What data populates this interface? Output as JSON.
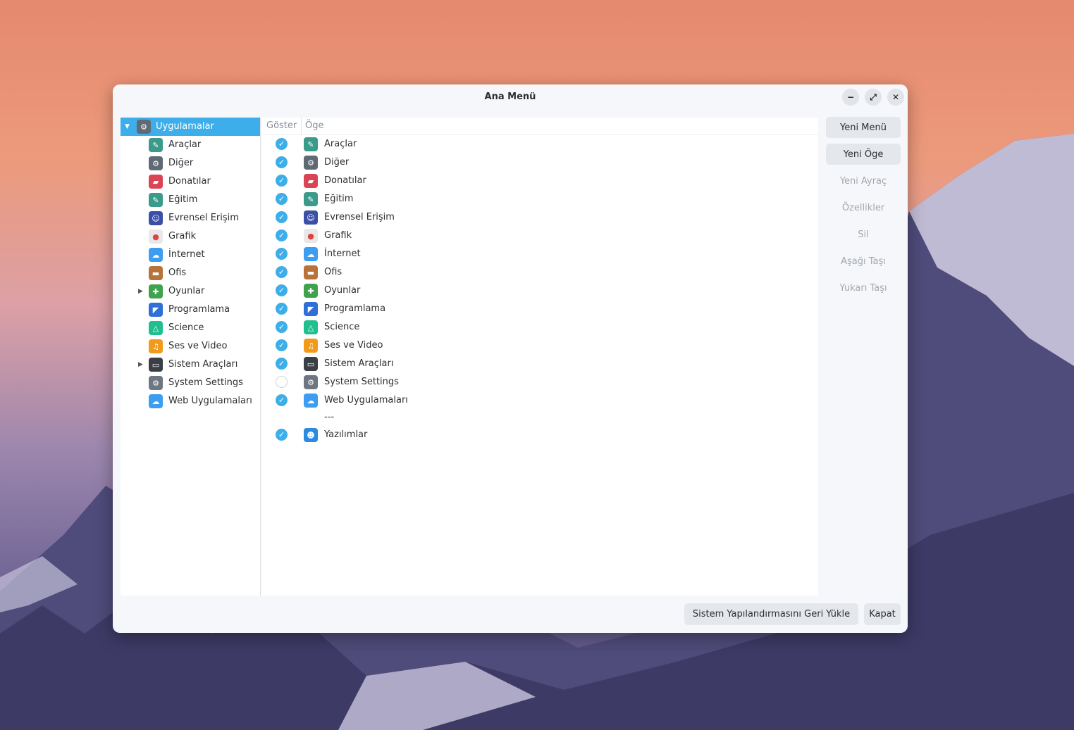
{
  "window": {
    "title": "Ana Menü",
    "controls": {
      "minimize": "−",
      "maximize": "⤢",
      "close": "✕"
    }
  },
  "tree": {
    "root": {
      "label": "Uygulamalar",
      "icon": "gear-icon"
    },
    "items": [
      {
        "label": "Araçlar",
        "icon": "tools-icon",
        "color": "#3b9b8a",
        "expandable": false
      },
      {
        "label": "Diğer",
        "icon": "gear-icon",
        "color": "#5f6a75",
        "expandable": false
      },
      {
        "label": "Donatılar",
        "icon": "toolbox-icon",
        "color": "#da4453",
        "expandable": false
      },
      {
        "label": "Eğitim",
        "icon": "education-icon",
        "color": "#3b9b8a",
        "expandable": false
      },
      {
        "label": "Evrensel Erişim",
        "icon": "accessibility-icon",
        "color": "#3b4fa8",
        "expandable": false
      },
      {
        "label": "Grafik",
        "icon": "palette-icon",
        "color": "#e8e8e8",
        "expandable": false
      },
      {
        "label": "İnternet",
        "icon": "cloud-icon",
        "color": "#3d9df0",
        "expandable": false
      },
      {
        "label": "Ofis",
        "icon": "briefcase-icon",
        "color": "#b8733a",
        "expandable": false
      },
      {
        "label": "Oyunlar",
        "icon": "gamepad-icon",
        "color": "#3fa34d",
        "expandable": true
      },
      {
        "label": "Programlama",
        "icon": "code-icon",
        "color": "#2f6fd6",
        "expandable": false
      },
      {
        "label": "Science",
        "icon": "flask-icon",
        "color": "#1fbf8f",
        "expandable": false
      },
      {
        "label": "Ses ve Video",
        "icon": "multimedia-icon",
        "color": "#f29b1b",
        "expandable": false
      },
      {
        "label": "Sistem Araçları",
        "icon": "monitor-icon",
        "color": "#3a3f46",
        "expandable": true
      },
      {
        "label": "System Settings",
        "icon": "settings-gear-icon",
        "color": "#6e7781",
        "expandable": false
      },
      {
        "label": "Web Uygulamaları",
        "icon": "cloud-icon",
        "color": "#3d9df0",
        "expandable": false
      }
    ]
  },
  "list": {
    "headers": {
      "show": "Göster",
      "item": "Öge"
    },
    "rows": [
      {
        "label": "Araçlar",
        "icon": "tools-icon",
        "color": "#3b9b8a",
        "checked": true
      },
      {
        "label": "Diğer",
        "icon": "gear-icon",
        "color": "#5f6a75",
        "checked": true
      },
      {
        "label": "Donatılar",
        "icon": "toolbox-icon",
        "color": "#da4453",
        "checked": true
      },
      {
        "label": "Eğitim",
        "icon": "education-icon",
        "color": "#3b9b8a",
        "checked": true
      },
      {
        "label": "Evrensel Erişim",
        "icon": "accessibility-icon",
        "color": "#3b4fa8",
        "checked": true
      },
      {
        "label": "Grafik",
        "icon": "palette-icon",
        "color": "#e8e8e8",
        "checked": true
      },
      {
        "label": "İnternet",
        "icon": "cloud-icon",
        "color": "#3d9df0",
        "checked": true
      },
      {
        "label": "Ofis",
        "icon": "briefcase-icon",
        "color": "#b8733a",
        "checked": true
      },
      {
        "label": "Oyunlar",
        "icon": "gamepad-icon",
        "color": "#3fa34d",
        "checked": true
      },
      {
        "label": "Programlama",
        "icon": "code-icon",
        "color": "#2f6fd6",
        "checked": true
      },
      {
        "label": "Science",
        "icon": "flask-icon",
        "color": "#1fbf8f",
        "checked": true
      },
      {
        "label": "Ses ve Video",
        "icon": "multimedia-icon",
        "color": "#f29b1b",
        "checked": true
      },
      {
        "label": "Sistem Araçları",
        "icon": "monitor-icon",
        "color": "#3a3f46",
        "checked": true
      },
      {
        "label": "System Settings",
        "icon": "settings-gear-icon",
        "color": "#6e7781",
        "checked": false
      },
      {
        "label": "Web Uygulamaları",
        "icon": "cloud-icon",
        "color": "#3d9df0",
        "checked": true
      }
    ],
    "separator": "---",
    "last_row": {
      "label": "Yazılımlar",
      "icon": "software-store-icon",
      "color": "#2b8be0",
      "checked": true
    }
  },
  "side_buttons": [
    {
      "label": "Yeni Menü",
      "enabled": true
    },
    {
      "label": "Yeni Öge",
      "enabled": true
    },
    {
      "label": "Yeni Ayraç",
      "enabled": false
    },
    {
      "label": "Özellikler",
      "enabled": false
    },
    {
      "label": "Sil",
      "enabled": false
    },
    {
      "label": "Aşağı Taşı",
      "enabled": false
    },
    {
      "label": "Yukarı Taşı",
      "enabled": false
    }
  ],
  "bottom_buttons": {
    "restore": "Sistem Yapılandırmasını Geri Yükle",
    "close": "Kapat"
  },
  "colors": {
    "accent": "#3daee9"
  }
}
